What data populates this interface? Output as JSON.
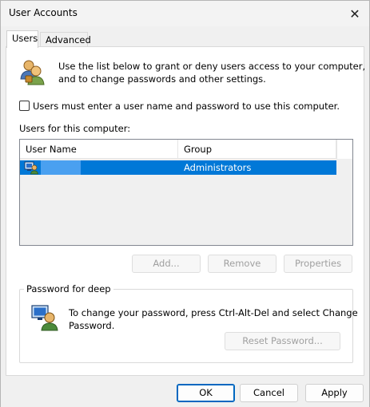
{
  "window": {
    "title": "User Accounts",
    "close_glyph": "✕"
  },
  "tabs": [
    {
      "label": "Users",
      "active": true
    },
    {
      "label": "Advanced",
      "active": false
    }
  ],
  "users_tab": {
    "intro_line1": "Use the list below to grant or deny users access to your computer,",
    "intro_line2": "and to change passwords and other settings.",
    "checkbox_label": "Users must enter a user name and password to use this computer.",
    "checkbox_checked": false,
    "list_label": "Users for this computer:",
    "columns": [
      "User Name",
      "Group"
    ],
    "rows": [
      {
        "user_name": "",
        "group": "Administrators",
        "selected": true
      }
    ],
    "buttons": {
      "add": "Add...",
      "remove": "Remove",
      "properties": "Properties"
    },
    "password_group": {
      "legend": "Password for deep",
      "text_line1": "To change your password, press Ctrl-Alt-Del and select Change",
      "text_line2": "Password.",
      "reset_button": "Reset Password..."
    }
  },
  "dialog_buttons": {
    "ok": "OK",
    "cancel": "Cancel",
    "apply": "Apply"
  },
  "colors": {
    "selection": "#0078d7",
    "accent_border": "#0067c0"
  },
  "icons": {
    "users": "users-group-icon",
    "user_row": "user-computer-icon",
    "password": "user-monitor-icon"
  }
}
